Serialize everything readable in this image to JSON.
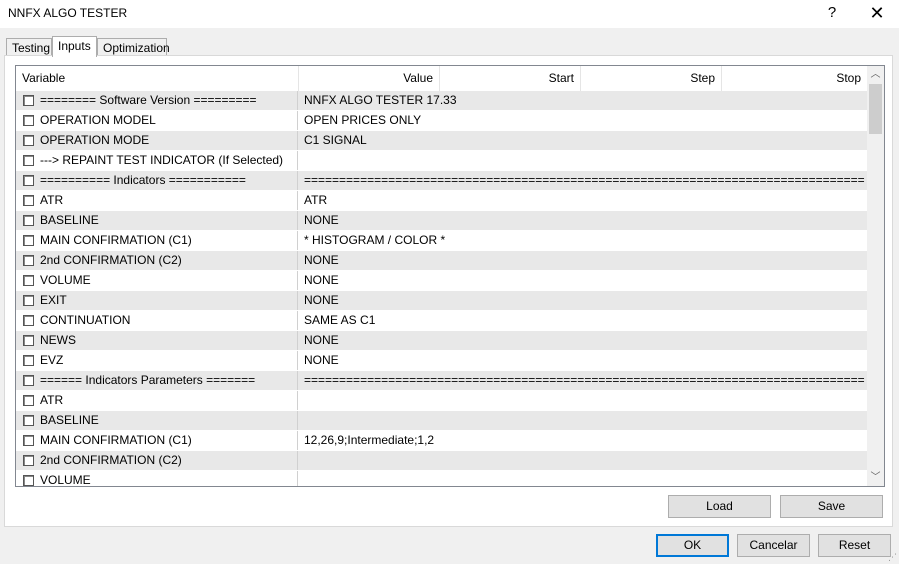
{
  "window": {
    "title": "NNFX ALGO TESTER",
    "help_glyph": "?",
    "close_glyph": "✕"
  },
  "tabs": [
    {
      "label": "Testing",
      "active": false
    },
    {
      "label": "Inputs",
      "active": true
    },
    {
      "label": "Optimization",
      "active": false
    }
  ],
  "grid": {
    "headers": {
      "variable": "Variable",
      "value": "Value",
      "start": "Start",
      "step": "Step",
      "stop": "Stop"
    },
    "rows": [
      {
        "variable": "======== Software Version =========",
        "value": "NNFX ALGO TESTER 17.33"
      },
      {
        "variable": "OPERATION MODEL",
        "value": "OPEN PRICES ONLY"
      },
      {
        "variable": "OPERATION MODE",
        "value": "C1 SIGNAL"
      },
      {
        "variable": "---> REPAINT TEST INDICATOR (If Selected)",
        "value": ""
      },
      {
        "variable": "========== Indicators ===========",
        "value": "========================================================================================..."
      },
      {
        "variable": "ATR",
        "value": "ATR"
      },
      {
        "variable": "BASELINE",
        "value": "NONE"
      },
      {
        "variable": "MAIN CONFIRMATION (C1)",
        "value": "* HISTOGRAM / COLOR *"
      },
      {
        "variable": "2nd CONFIRMATION (C2)",
        "value": "NONE"
      },
      {
        "variable": "VOLUME",
        "value": "NONE"
      },
      {
        "variable": "EXIT",
        "value": "NONE"
      },
      {
        "variable": "CONTINUATION",
        "value": "SAME AS C1"
      },
      {
        "variable": "NEWS",
        "value": "NONE"
      },
      {
        "variable": "EVZ",
        "value": "NONE"
      },
      {
        "variable": "====== Indicators Parameters =======",
        "value": "========================================================================================..."
      },
      {
        "variable": "ATR",
        "value": ""
      },
      {
        "variable": "BASELINE",
        "value": ""
      },
      {
        "variable": "MAIN CONFIRMATION (C1)",
        "value": "12,26,9;Intermediate;1,2"
      },
      {
        "variable": "2nd CONFIRMATION (C2)",
        "value": ""
      },
      {
        "variable": "VOLUME",
        "value": ""
      }
    ]
  },
  "scrollbar": {
    "up_glyph": "︿",
    "down_glyph": "﹀"
  },
  "buttons": {
    "load": "Load",
    "save": "Save",
    "ok": "OK",
    "cancel": "Cancelar",
    "reset": "Reset"
  }
}
